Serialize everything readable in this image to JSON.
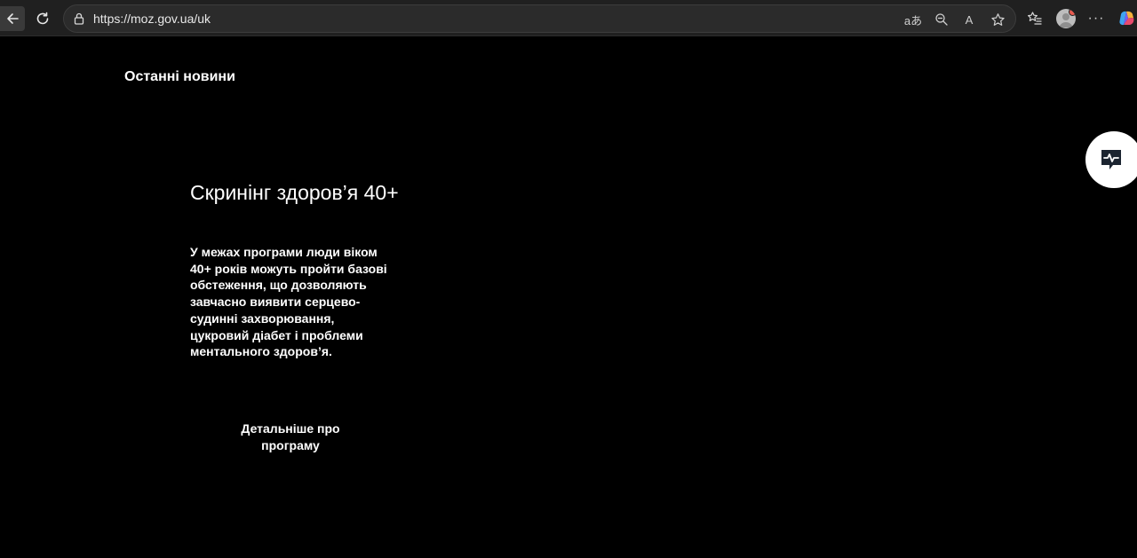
{
  "browser": {
    "url": "https://moz.gov.ua/uk",
    "icons": {
      "back": "back-arrow-icon",
      "reload": "reload-icon",
      "lock": "lock-icon",
      "translate": "translate-icon",
      "translate_glyph": "aあ",
      "zoom": "zoom-out-icon",
      "read_aloud": "read-aloud-icon",
      "read_aloud_glyph": "A",
      "favorite": "star-icon",
      "favorites": "favorites-list-icon",
      "profile": "avatar",
      "more": "more-icon",
      "more_glyph": "···",
      "copilot": "copilot-icon"
    },
    "colors": {
      "toolbar": "#202020",
      "address_bar": "#2b2b2b",
      "profile_badge": "#e85a4f"
    }
  },
  "page": {
    "news_heading": "Останні новини",
    "promo": {
      "title": "Скринінг здоров’я 40+",
      "text": "У межах програми люди віком 40+ років можуть пройти базові обстеження, що дозволяють завчасно виявити серцево-судинні захворювання, цукровий діабет і проблеми ментального здоров’я.",
      "link_label": "Детальніше про програму"
    },
    "side_widget": {
      "icon": "health-chat-icon",
      "color": "#1b2430"
    },
    "colors": {
      "background": "#000000",
      "text": "#ffffff"
    }
  }
}
